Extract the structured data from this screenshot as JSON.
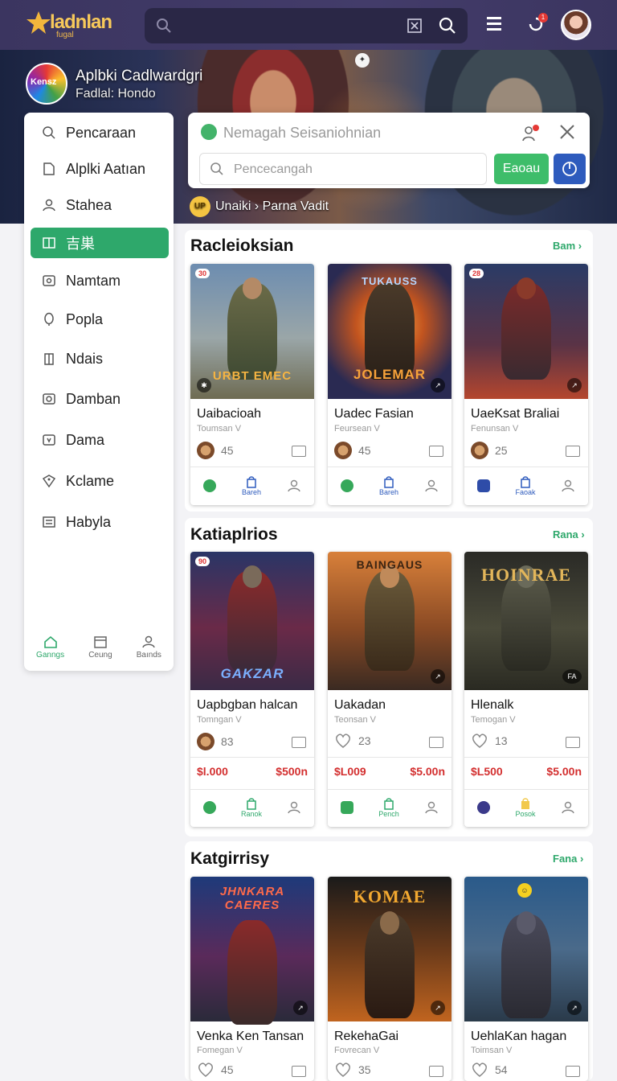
{
  "topbar": {
    "brand": "ladnlan",
    "brand_sub": "fugal",
    "notification_count": "1"
  },
  "hero": {
    "logo_text": "Kensz",
    "title": "Aplbki Cadlwardgri",
    "subtitle": "Fadlal: Hondo",
    "tag": "Unaiki › Parna Vadit",
    "tag_badge": "UP"
  },
  "sidebar": {
    "items": [
      {
        "label": "Pencaraan",
        "icon": "search-icon"
      },
      {
        "label": "Alplki Aatıan",
        "icon": "folder-icon"
      },
      {
        "label": "Stahea",
        "icon": "user-icon"
      },
      {
        "label": "吉巣",
        "icon": "book-icon",
        "active": true
      },
      {
        "label": "Namtam",
        "icon": "image-icon"
      },
      {
        "label": "Popla",
        "icon": "pin-icon"
      },
      {
        "label": "Ndais",
        "icon": "building-icon"
      },
      {
        "label": "Damban",
        "icon": "camera-icon"
      },
      {
        "label": "Dama",
        "icon": "shield-icon"
      },
      {
        "label": "Kclame",
        "icon": "tag-icon"
      },
      {
        "label": "Habyla",
        "icon": "list-icon"
      }
    ],
    "footer": [
      {
        "label": "Ganngs",
        "icon": "home-icon"
      },
      {
        "label": "Ceung",
        "icon": "calendar-icon"
      },
      {
        "label": "Baınds",
        "icon": "person-icon"
      }
    ]
  },
  "panel": {
    "message": "Nemagah Seisaniohnian",
    "input_placeholder": "Pencecangah",
    "primary_button": "Eaoau"
  },
  "sections": [
    {
      "title": "Racleioksian",
      "more": "Bam ›",
      "cards": [
        {
          "name": "Uaibacioah",
          "meta": "Toumsan V",
          "count": "45",
          "badge": "30",
          "art": "URBT EMEC",
          "action_label": "Bareh"
        },
        {
          "name": "Uadec Fasian",
          "meta": "Feursean V",
          "count": "45",
          "art_top": "TUKAUSS",
          "art": "JOLEMAR",
          "action_label": "Bareh"
        },
        {
          "name": "UaeKsat Braliai",
          "meta": "Fenunsan V",
          "count": "25",
          "badge": "28",
          "action_label": "Faoak"
        }
      ]
    },
    {
      "title": "Katiaplrios",
      "more": "Rana ›",
      "cards": [
        {
          "name": "Uapbgban halcan",
          "meta": "Tomngan V",
          "count": "83",
          "badge": "90",
          "art": "GAKZAR",
          "price_left": "$l.000",
          "price_right": "$500n",
          "action_label": "Ranok"
        },
        {
          "name": "Uakadan",
          "meta": "Teonsan V",
          "count": "23",
          "art_top": "BAINGAUS",
          "price_left": "$L009",
          "price_right": "$5.00n",
          "action_label": "Pench"
        },
        {
          "name": "Hlenalk",
          "meta": "Temogan V",
          "count": "13",
          "art_top": "HOINRAE",
          "corner": "FA",
          "price_left": "$L500",
          "price_right": "$5.00n",
          "action_label": "Posok"
        }
      ]
    },
    {
      "title": "Katgirrisy",
      "more": "Fana ›",
      "cards": [
        {
          "name": "Venka Ken Tansan",
          "meta": "Fomegan V",
          "count": "45",
          "art_top": "JHNKARA CAERES"
        },
        {
          "name": "RekehaGai",
          "meta": "Fovrecan V",
          "count": "35",
          "art_top": "KOMAE"
        },
        {
          "name": "UehlaKan hagan",
          "meta": "Toimsan V",
          "count": "54"
        }
      ]
    }
  ],
  "colors": {
    "topbar": "#3b3560",
    "accent_green": "#2ea86b",
    "accent_blue": "#2e5bbd",
    "price_red": "#d32f2f"
  }
}
